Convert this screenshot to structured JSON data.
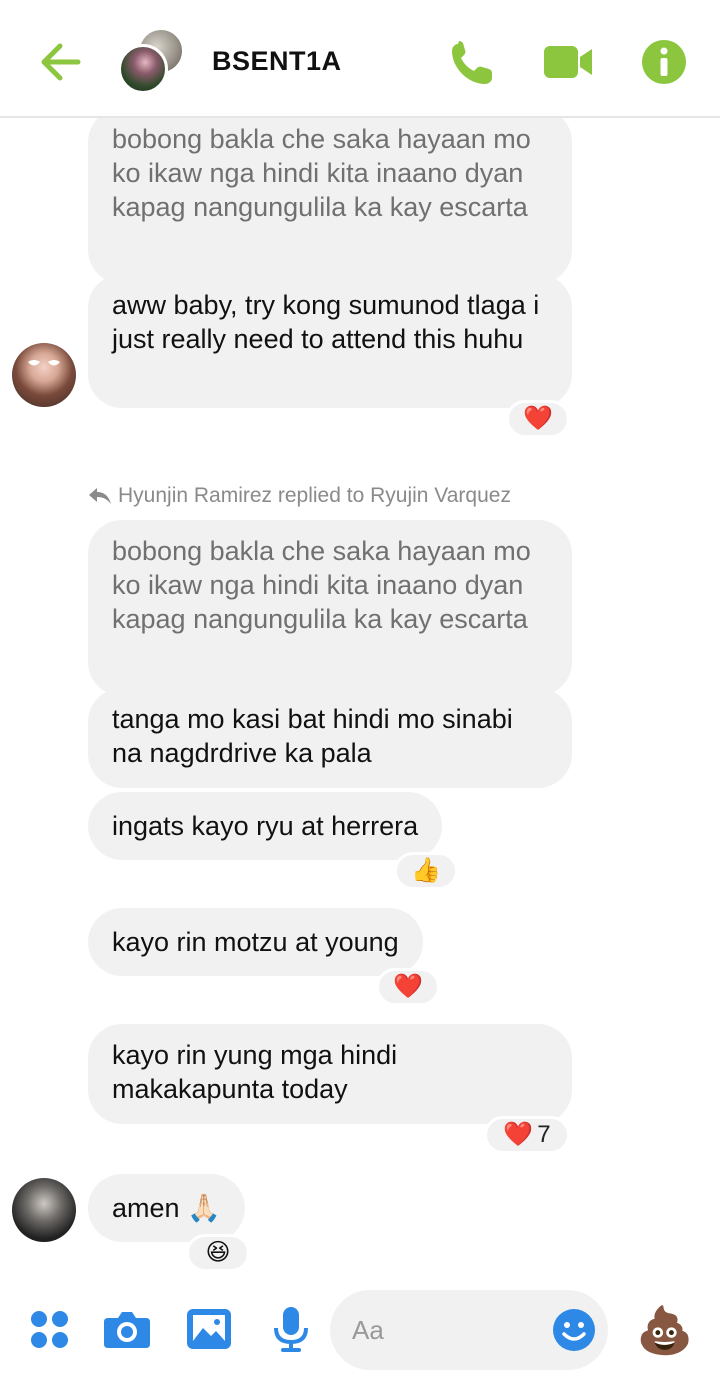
{
  "header": {
    "title": "BSENT1A",
    "accent_color": "#8cc63f",
    "icons": [
      "back-arrow-icon",
      "phone-icon",
      "video-camera-icon",
      "info-icon"
    ]
  },
  "messages": [
    {
      "text": "bobong bakla che saka hayaan mo ko ikaw nga hindi kita inaano dyan kapag nangungulila ka kay escarta",
      "style": "quoted"
    },
    {
      "text": "aww baby, try kong sumunod tlaga i just really need to attend this huhu",
      "reaction": "❤️"
    },
    {
      "reply_note": "Hyunjin Ramirez replied to Ryujin Varquez"
    },
    {
      "text": "bobong bakla che saka hayaan mo ko ikaw nga hindi kita inaano dyan kapag nangungulila ka kay escarta",
      "style": "quoted"
    },
    {
      "text": "tanga mo kasi bat hindi mo sinabi na nagdrdrive ka pala"
    },
    {
      "text": "ingats kayo ryu at herrera",
      "reaction": "👍"
    },
    {
      "text": "kayo rin motzu at young",
      "reaction": "❤️"
    },
    {
      "text": "kayo rin yung mga hindi makakapunta today",
      "reaction": "❤️",
      "reaction_count": "7"
    },
    {
      "text": "amen 🙏🏻",
      "reaction": "😆"
    }
  ],
  "composer": {
    "placeholder": "Aa",
    "like_emoji": "💩",
    "accent_color": "#2d88e6",
    "icons": [
      "menu-grid-icon",
      "camera-icon",
      "image-icon",
      "microphone-icon",
      "emoji-icon"
    ]
  }
}
